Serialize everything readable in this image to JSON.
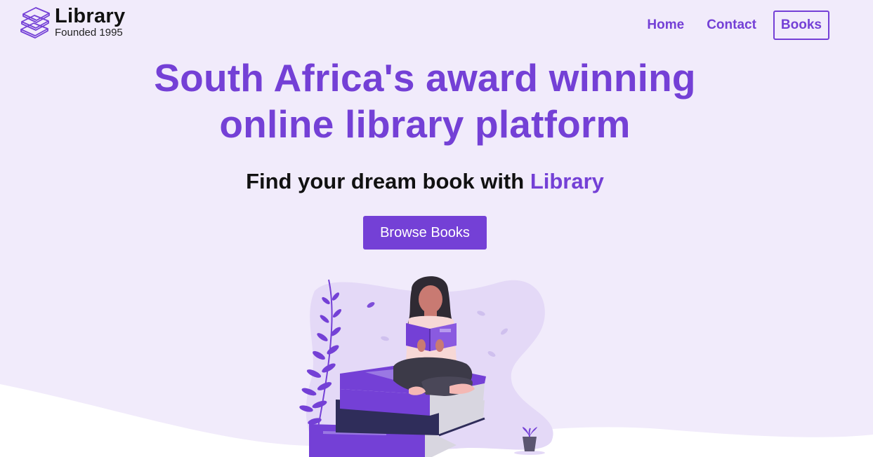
{
  "brand": {
    "name": "Library",
    "tagline": "Founded 1995",
    "icon": "books-stack-icon"
  },
  "nav": {
    "items": [
      {
        "label": "Home",
        "active": false
      },
      {
        "label": "Contact",
        "active": false
      },
      {
        "label": "Books",
        "active": true
      }
    ]
  },
  "hero": {
    "title_line1": "South Africa's award winning",
    "title_line2": "online library platform",
    "subtitle_prefix": "Find your dream book with ",
    "subtitle_accent": "Library",
    "cta_label": "Browse Books"
  },
  "colors": {
    "accent": "#7440d6",
    "background": "#f1ebfb",
    "wave": "#ffffff",
    "blob": "#e4d9f7",
    "text": "#111111"
  }
}
